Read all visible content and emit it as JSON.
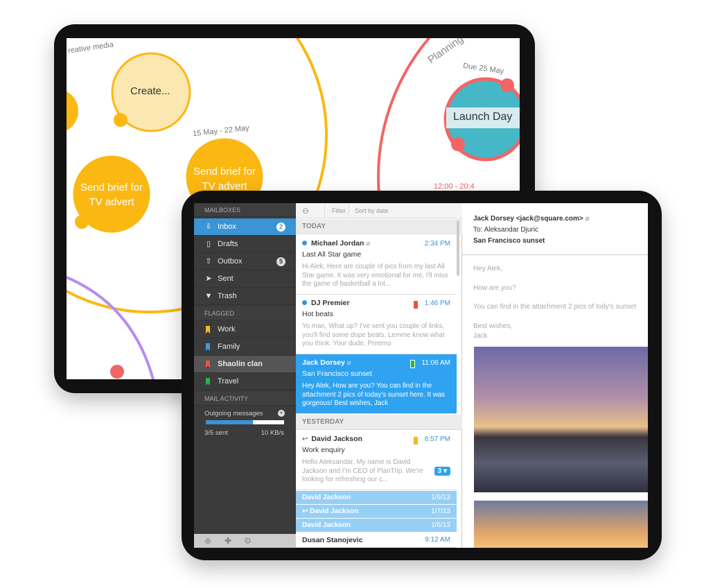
{
  "back_ipad": {
    "labels": {
      "group": "reative media",
      "create": "Create...",
      "date_range": "15 May - 22 May",
      "brief1": "Send brief for TV advert",
      "brief2": "Send brief for TV advert",
      "planning": "Planning",
      "due": "Due 25 May",
      "launch": "Launch Day",
      "time_range": "12:00 - 20:4"
    },
    "colors": {
      "yellow": "#fbb813",
      "red": "#f26565",
      "purple": "#b58cf0"
    }
  },
  "sidebar": {
    "mailboxes_header": "MAILBOXES",
    "mailboxes": [
      {
        "label": "Inbox",
        "icon": "inbox-icon",
        "badge": "2",
        "active": true
      },
      {
        "label": "Drafts",
        "icon": "document-icon"
      },
      {
        "label": "Outbox",
        "icon": "outbox-icon",
        "badge": "5"
      },
      {
        "label": "Sent",
        "icon": "paper-plane-icon"
      },
      {
        "label": "Trash",
        "icon": "trash-icon"
      }
    ],
    "flagged_header": "FLAGGED",
    "flagged": [
      {
        "label": "Work",
        "color": "#f5b820"
      },
      {
        "label": "Family",
        "color": "#3a9be6"
      },
      {
        "label": "Shaolin clan",
        "color": "#f0503c",
        "selected": true
      },
      {
        "label": "Travel",
        "color": "#2cb43c"
      }
    ],
    "activity_header": "MAIL ACTIVITY",
    "activity": {
      "title": "Outgoing messages",
      "progress": 0.6,
      "sent": "3/5 sent",
      "speed": "10 KB/s"
    }
  },
  "list": {
    "toolbar": {
      "filter": "Filter",
      "sort": "Sort by date"
    },
    "today": "TODAY",
    "yesterday": "YESTERDAY",
    "messages": [
      {
        "from": "Michael Jordan",
        "time": "2:34 PM",
        "subject": "Last All Star game",
        "preview": "Hi Alek, Here are couple of pics from my last All Star game. It was very emotional for me, I'll miss the game of basketball a lot..."
      },
      {
        "from": "DJ Premier",
        "time": "1:46 PM",
        "subject": "Hot beats",
        "preview": "Yo man, What up? I've sent you couple of links, you'll find some dope beats. Lemme know what you think. Your dude, Preemo"
      },
      {
        "from": "Jack Dorsey",
        "time": "11:06 AM",
        "subject": "San Francisco sunset",
        "preview": "Hey Alek, How are you? You can find in the attachment 2 pics of today's sunset here. It was gorgeous! Best wishes, Jack"
      },
      {
        "from": "David Jackson",
        "time": "6:57 PM",
        "subject": "Work enquiry",
        "preview": "Hello Aleksandar, My name is David Jackson and I'm CEO of PlanTrip. We're looking for refreshing our c...",
        "thread_count": "3"
      }
    ],
    "threads": [
      {
        "from": "David Jackson",
        "date": "1/9/13"
      },
      {
        "from": "David Jackson",
        "date": "1/7/13"
      },
      {
        "from": "David Jackson",
        "date": "1/6/13"
      }
    ],
    "last": {
      "from": "Dusan Stanojevic",
      "time": "9:12 AM"
    }
  },
  "detail": {
    "from": "Jack Dorsey <jack@square.com>",
    "to": "To: Aleksandar Djuric",
    "subject": "San Francisco sunset",
    "body": [
      "Hey Alek,",
      "How are you?",
      "You can find in the attachment 2 pics of tody's sunset",
      "Best wishes,",
      "Jack"
    ]
  }
}
